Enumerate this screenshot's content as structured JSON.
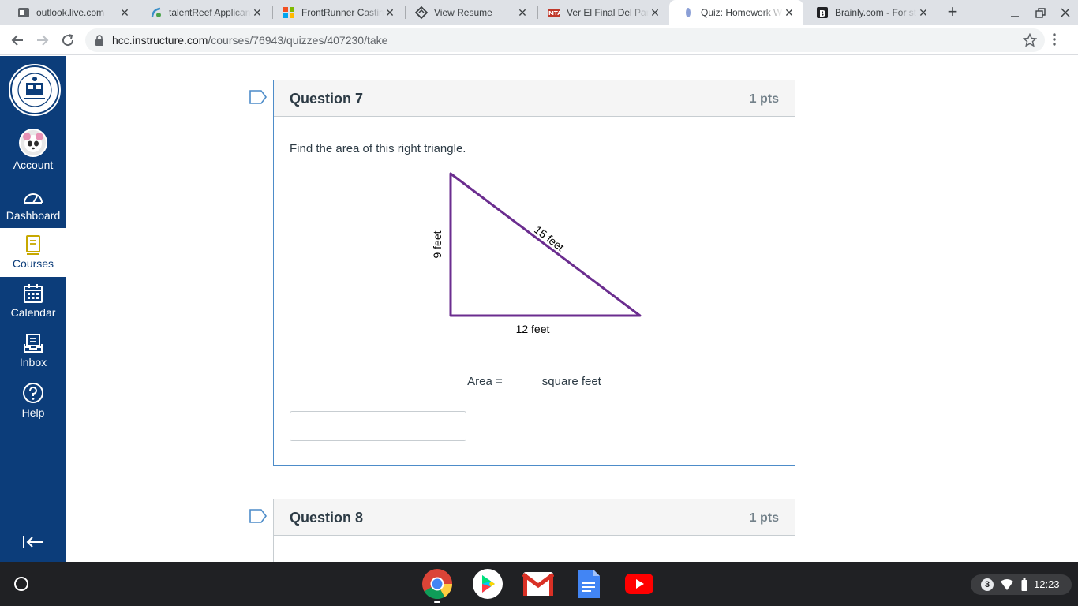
{
  "browser": {
    "tabs": [
      {
        "title": "outlook.live.com",
        "icon": "outlook-icon",
        "active": false
      },
      {
        "title": "talentReef Applicant",
        "icon": "talentreef-icon",
        "active": false
      },
      {
        "title": "FrontRunner Casting",
        "icon": "frontrunner-icon",
        "active": false
      },
      {
        "title": "View Resume",
        "icon": "resume-icon",
        "active": false
      },
      {
        "title": "Ver El Final Del Partido",
        "icon": "mta-icon",
        "active": false
      },
      {
        "title": "Quiz: Homework Week",
        "icon": "canvas-icon",
        "active": true
      },
      {
        "title": "Brainly.com - For students",
        "icon": "brainly-icon",
        "active": false
      }
    ],
    "url_host": "hcc.instructure.com",
    "url_path": "/courses/76943/quizzes/407230/take"
  },
  "nav": {
    "items": [
      {
        "label": "Account",
        "icon": "account-avatar-icon"
      },
      {
        "label": "Dashboard",
        "icon": "dashboard-icon"
      },
      {
        "label": "Courses",
        "icon": "courses-icon",
        "active": true
      },
      {
        "label": "Calendar",
        "icon": "calendar-icon"
      },
      {
        "label": "Inbox",
        "icon": "inbox-icon"
      },
      {
        "label": "Help",
        "icon": "help-icon"
      }
    ]
  },
  "quiz": {
    "questions": [
      {
        "name": "Question 7",
        "points": "1 pts",
        "prompt": "Find the area of this right triangle.",
        "figure": {
          "left_side": "9 feet",
          "hypotenuse": "15 feet",
          "bottom_side": "12 feet"
        },
        "area_text": "Area = _____ square feet",
        "answer_value": ""
      },
      {
        "name": "Question 8",
        "points": "1 pts"
      }
    ]
  },
  "shelf": {
    "apps": [
      "chrome-icon",
      "play-store-icon",
      "gmail-icon",
      "docs-icon",
      "youtube-icon"
    ],
    "notification_count": "3",
    "time": "12:23"
  },
  "colors": {
    "nav_bg": "#0c3d7a",
    "triangle_stroke": "#6b2d8f",
    "question_border": "#4d8cc9",
    "active_nav_text": "#0c3d7a"
  }
}
